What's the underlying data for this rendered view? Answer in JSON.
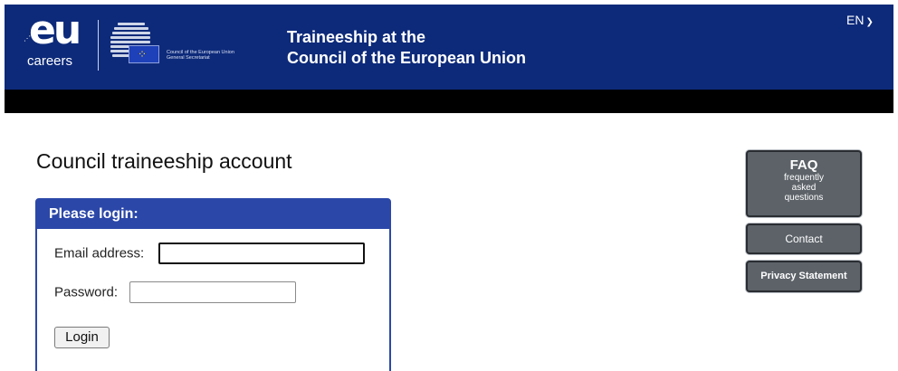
{
  "header": {
    "eu_logo_text": "eu",
    "eu_logo_sub": "careers",
    "council_logo_line1": "Council of the European Union",
    "council_logo_line2": "General Secretariat",
    "title_line1": "Traineeship at the",
    "title_line2": "Council of the European Union",
    "language": "EN"
  },
  "main": {
    "page_title": "Council traineeship account"
  },
  "login": {
    "heading": "Please login:",
    "email_label": "Email address:",
    "email_value": "",
    "password_label": "Password:",
    "password_value": "",
    "button_label": "Login"
  },
  "side_buttons": {
    "faq_main": "FAQ",
    "faq_line1": "frequently",
    "faq_line2": "asked",
    "faq_line3": "questions",
    "contact": "Contact",
    "privacy": "Privacy Statement"
  },
  "colors": {
    "header_bg": "#0d2a7a",
    "panel_accent": "#2b47a8",
    "side_button_bg": "#5c6268"
  },
  "icons": {
    "language_chevron": "chevron-down-icon",
    "eu_flag": "eu-flag-icon"
  }
}
